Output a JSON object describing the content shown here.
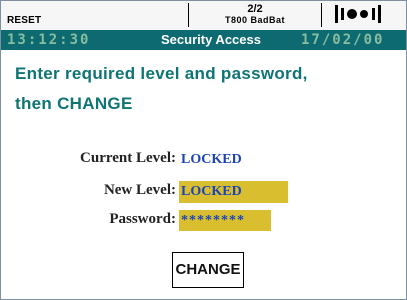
{
  "header": {
    "reset_label": "RESET",
    "page_indicator": "2/2",
    "device_model": "T800 BadBat"
  },
  "titlebar": {
    "time": "13:12:30",
    "title": "Security Access",
    "date": "17/02/00"
  },
  "content": {
    "prompt_line1": "Enter required level and password,",
    "prompt_line2": "then CHANGE",
    "current_level_label": "Current Level:",
    "current_level_value": "LOCKED",
    "new_level_label": "New Level:",
    "new_level_value": "LOCKED",
    "password_label": "Password:",
    "password_value": "********"
  },
  "buttons": {
    "change_label": "CHANGE"
  },
  "icons": {
    "brand": "brand-logo-icon"
  },
  "colors": {
    "title_bar": "#0d6a70",
    "prompt_text": "#0e7474",
    "field_value": "#1b43b8",
    "field_highlight": "#d9bf2f"
  }
}
